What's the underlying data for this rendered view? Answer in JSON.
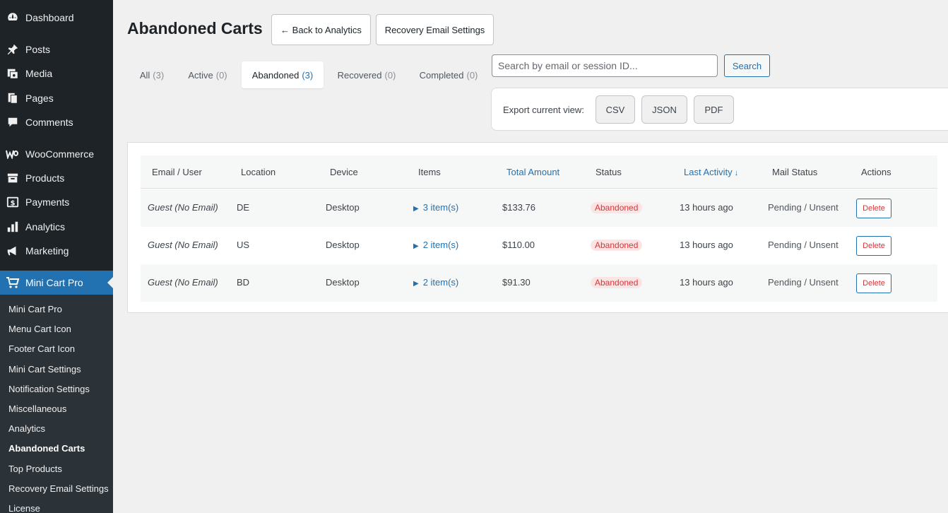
{
  "sidebar": {
    "menu": [
      {
        "label": "Dashboard",
        "icon": "dashboard-icon"
      },
      {
        "label": "Posts",
        "icon": "pin-icon"
      },
      {
        "label": "Media",
        "icon": "media-icon"
      },
      {
        "label": "Pages",
        "icon": "pages-icon"
      },
      {
        "label": "Comments",
        "icon": "comment-icon"
      },
      {
        "label": "WooCommerce",
        "icon": "woo-icon"
      },
      {
        "label": "Products",
        "icon": "archive-icon"
      },
      {
        "label": "Payments",
        "icon": "dollar-icon"
      },
      {
        "label": "Analytics",
        "icon": "bar-chart-icon"
      },
      {
        "label": "Marketing",
        "icon": "megaphone-icon"
      },
      {
        "label": "Mini Cart Pro",
        "icon": "cart-icon"
      }
    ],
    "submenu": [
      "Mini Cart Pro",
      "Menu Cart Icon",
      "Footer Cart Icon",
      "Mini Cart Settings",
      "Notification Settings",
      "Miscellaneous",
      "Analytics",
      "Abandoned Carts",
      "Top Products",
      "Recovery Email Settings",
      "License"
    ]
  },
  "header": {
    "title": "Abandoned Carts",
    "back_label": "← Back to Analytics",
    "recovery_label": "Recovery Email Settings"
  },
  "tabs": [
    {
      "label": "All",
      "count": "(3)"
    },
    {
      "label": "Active",
      "count": "(0)"
    },
    {
      "label": "Abandoned",
      "count": "(3)"
    },
    {
      "label": "Recovered",
      "count": "(0)"
    },
    {
      "label": "Completed",
      "count": "(0)"
    }
  ],
  "search": {
    "placeholder": "Search by email or session ID...",
    "value": "",
    "button_label": "Search"
  },
  "export": {
    "label": "Export current view:",
    "csv": "CSV",
    "json": "JSON",
    "pdf": "PDF"
  },
  "table": {
    "columns": [
      "Email / User",
      "Location",
      "Device",
      "Items",
      "Total Amount",
      "Status",
      "Last Activity",
      "Mail Status",
      "Actions"
    ],
    "sort_arrow": "↓",
    "rows": [
      {
        "email": "Guest (No Email)",
        "location": "DE",
        "device": "Desktop",
        "items": "3 item(s)",
        "total": "$133.76",
        "status": "Abandoned",
        "last_activity": "13 hours ago",
        "mail_status": "Pending / Unsent",
        "action": "Delete"
      },
      {
        "email": "Guest (No Email)",
        "location": "US",
        "device": "Desktop",
        "items": "2 item(s)",
        "total": "$110.00",
        "status": "Abandoned",
        "last_activity": "13 hours ago",
        "mail_status": "Pending / Unsent",
        "action": "Delete"
      },
      {
        "email": "Guest (No Email)",
        "location": "BD",
        "device": "Desktop",
        "items": "2 item(s)",
        "total": "$91.30",
        "status": "Abandoned",
        "last_activity": "13 hours ago",
        "mail_status": "Pending / Unsent",
        "action": "Delete"
      }
    ]
  },
  "colors": {
    "accent": "#2271b1",
    "sidebar_bg": "#1d2327",
    "status_red": "#d63638"
  }
}
